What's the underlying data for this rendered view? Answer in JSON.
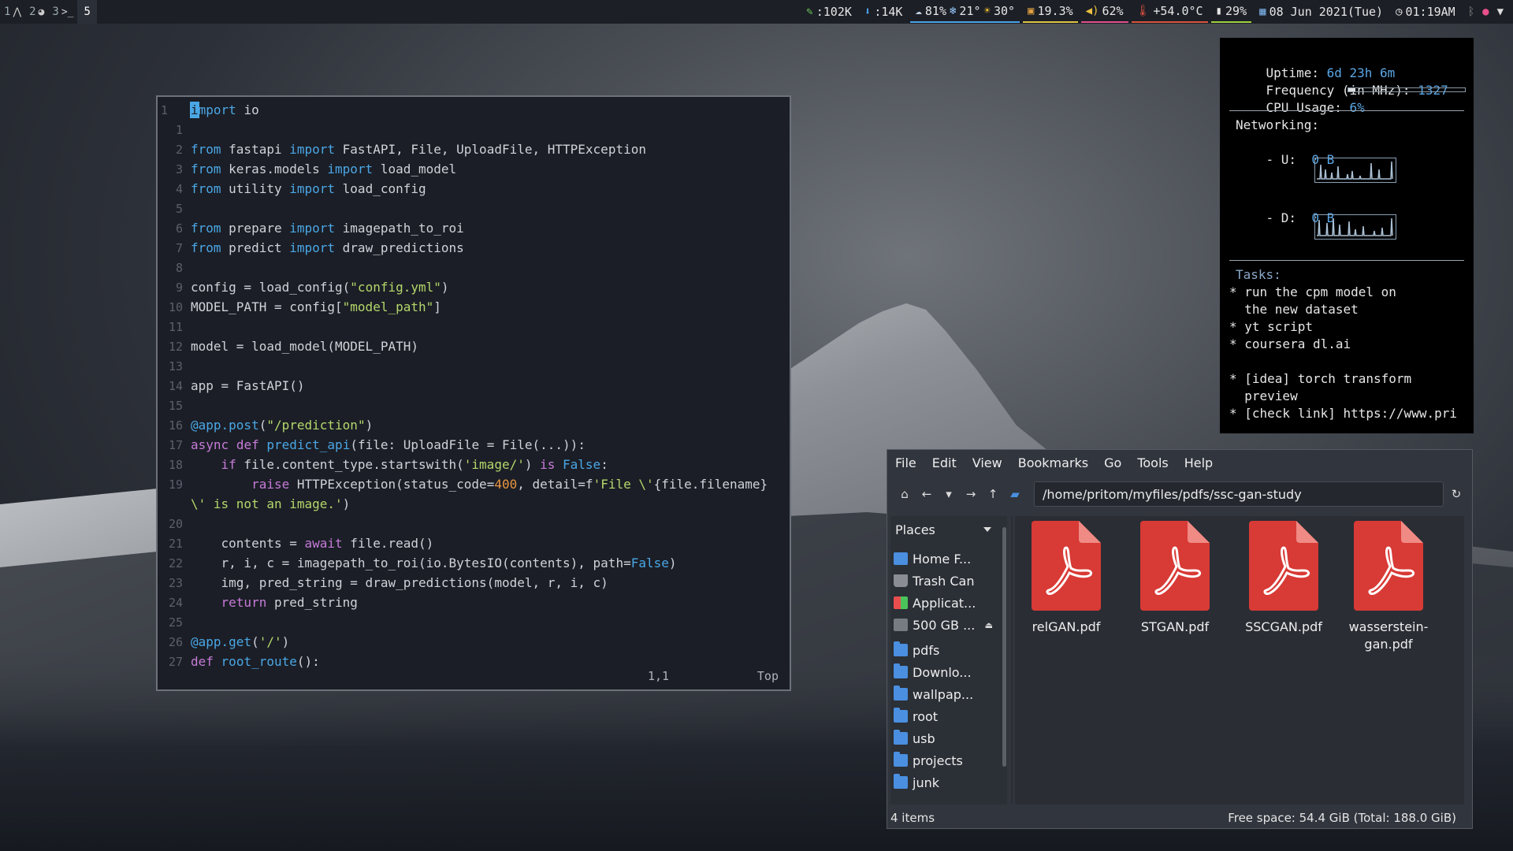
{
  "workspaces": [
    {
      "num": "1",
      "glyph": "⋀"
    },
    {
      "num": "2",
      "glyph": "◕"
    },
    {
      "num": "3",
      "glyph": ">_"
    },
    {
      "num": "5",
      "glyph": ""
    }
  ],
  "status": {
    "upload": ":102K",
    "download": ":14K",
    "humidity": "81%",
    "temp_low": "21°",
    "temp_high": "30°",
    "disk": "19.3%",
    "volume": "62%",
    "cpu_temp": "+54.0°C",
    "battery": "29%",
    "date": "08 Jun 2021(Tue)",
    "time": "01:19AM"
  },
  "editor": {
    "position": "1,1",
    "scroll": "Top"
  },
  "conky": {
    "uptime_label": "Uptime:",
    "uptime_value": "6d 23h 6m",
    "freq_label": "Frequency (in MHz):",
    "freq_value": "1327",
    "cpu_label": "CPU Usage:",
    "cpu_value": "6%",
    "cpu_fraction": 0.06,
    "net_label": "Networking:",
    "up_label": "- U:",
    "up_value": "0 B",
    "down_label": "- D:",
    "down_value": "0 B",
    "tasks_label": "Tasks:",
    "tasks": [
      "* run the cpm model on",
      "  the new dataset",
      "* yt script",
      "* coursera dl.ai",
      "",
      "* [idea] torch transform",
      "  preview",
      "* [check link] https://www.pri"
    ]
  },
  "filemanager": {
    "menu": [
      "File",
      "Edit",
      "View",
      "Bookmarks",
      "Go",
      "Tools",
      "Help"
    ],
    "location": "/home/pritom/myfiles/pdfs/ssc-gan-study",
    "places_label": "Places",
    "places": [
      {
        "label": "Home F...",
        "icon": "home"
      },
      {
        "label": "Trash Can",
        "icon": "trash"
      },
      {
        "label": "Applicat...",
        "icon": "apps"
      },
      {
        "label": "500 GB ...",
        "icon": "drive"
      },
      {
        "label": "pdfs",
        "icon": "folder"
      },
      {
        "label": "Downlo...",
        "icon": "folder"
      },
      {
        "label": "wallpap...",
        "icon": "folder"
      },
      {
        "label": "root",
        "icon": "folder"
      },
      {
        "label": "usb",
        "icon": "folder"
      },
      {
        "label": "projects",
        "icon": "folder"
      },
      {
        "label": "junk",
        "icon": "folder"
      }
    ],
    "files": [
      {
        "name": "relGAN.pdf"
      },
      {
        "name": "STGAN.pdf"
      },
      {
        "name": "SSCGAN.pdf"
      },
      {
        "name": "wasserstein-gan.pdf"
      }
    ],
    "item_count": "4 items",
    "free_space": "Free space: 54.4 GiB (Total: 188.0 GiB)"
  }
}
